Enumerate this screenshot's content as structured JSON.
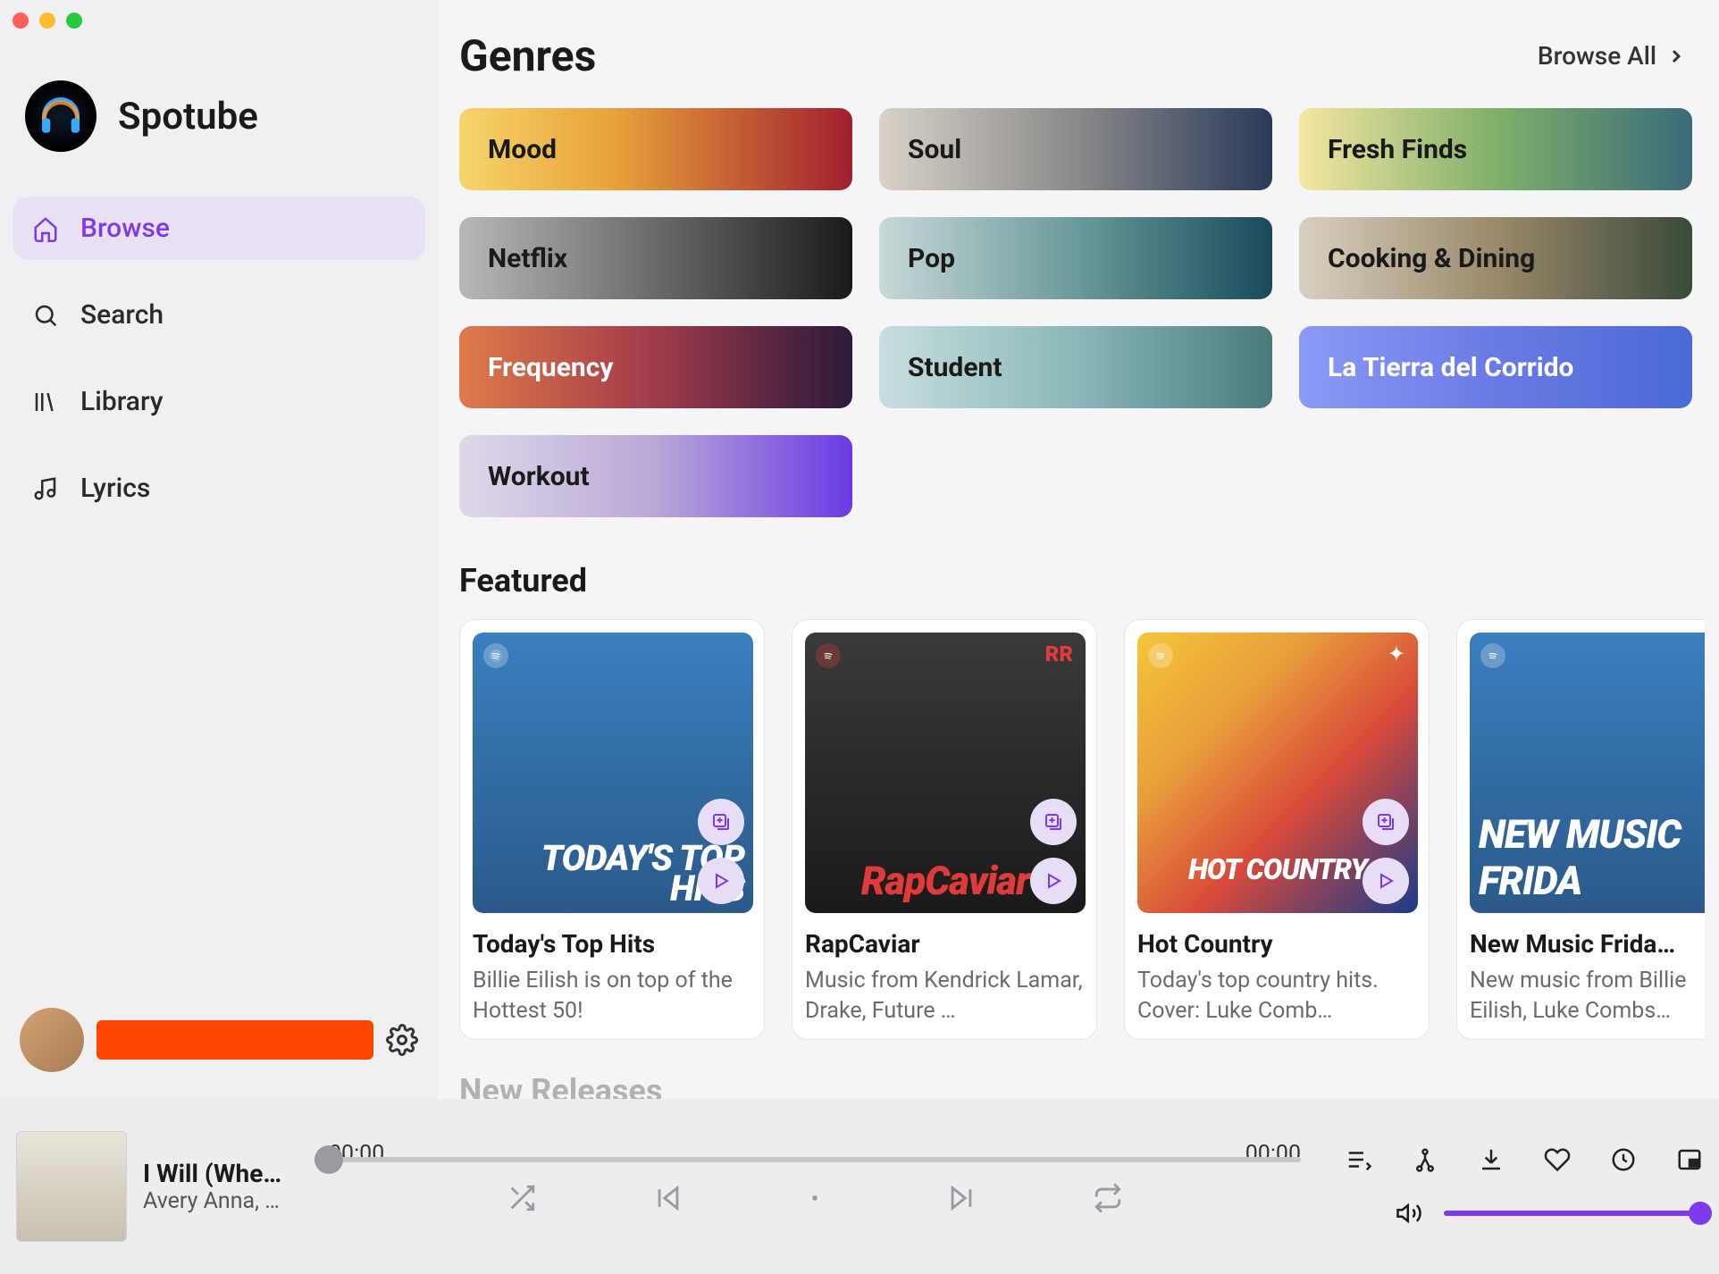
{
  "app": {
    "title": "Spotube"
  },
  "sidebar": {
    "items": [
      {
        "label": "Browse"
      },
      {
        "label": "Search"
      },
      {
        "label": "Library"
      },
      {
        "label": "Lyrics"
      }
    ]
  },
  "header": {
    "genres_title": "Genres",
    "browse_all": "Browse All",
    "featured_title": "Featured",
    "new_releases_title": "New Releases"
  },
  "genres": [
    "Mood",
    "Soul",
    "Fresh Finds",
    "Netflix",
    "Pop",
    "Cooking & Dining",
    "Frequency",
    "Student",
    "La Tierra del Corrido",
    "Workout"
  ],
  "featured": [
    {
      "title": "Today's Top Hits",
      "desc": "Billie Eilish is on top of the Hottest 50!",
      "overlay": "TODAY'S TOP HITS"
    },
    {
      "title": "RapCaviar",
      "desc": "Music from Kendrick Lamar, Drake, Future …",
      "overlay": "RapCaviar"
    },
    {
      "title": "Hot Country",
      "desc": "Today's top country hits. Cover: Luke Comb…",
      "overlay": "HOT COUNTRY"
    },
    {
      "title": "New Music Frida…",
      "desc": "New music from Billie Eilish, Luke Combs…",
      "overlay": "NEW MUSIC FRIDA"
    }
  ],
  "player": {
    "track": "I Will (Whe…",
    "artist": "Avery Anna, …",
    "elapsed": "00:00",
    "total": "00:00"
  },
  "colors": {
    "accent": "#7c3aed",
    "user_bar": "#ff4500"
  }
}
